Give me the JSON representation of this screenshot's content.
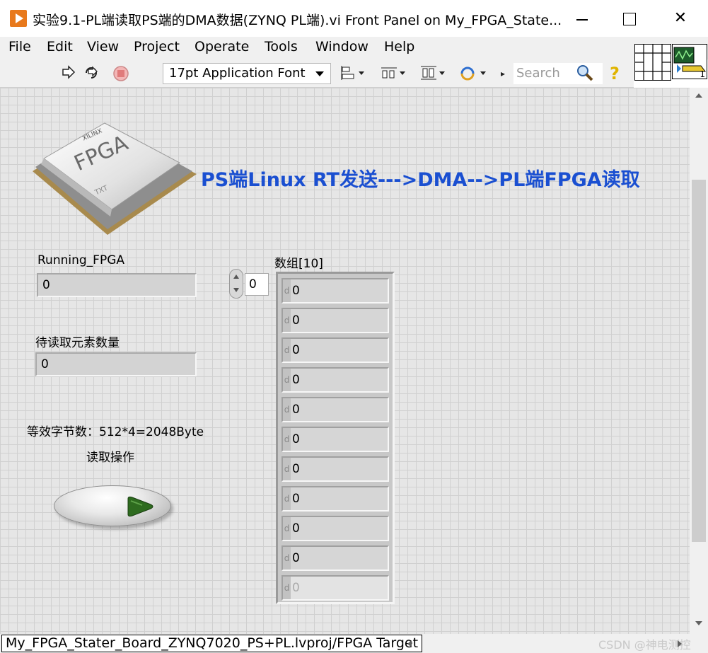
{
  "window": {
    "title": "实验9.1-PL端读取PS端的DMA数据(ZYNQ PL端).vi Front Panel on My_FPGA_State..."
  },
  "menu": {
    "items": [
      "File",
      "Edit",
      "View",
      "Project",
      "Operate",
      "Tools",
      "Window",
      "Help"
    ]
  },
  "toolbar": {
    "font_value": "17pt Application Font",
    "search_placeholder": "Search",
    "icons": [
      "run-arrow-icon",
      "run-continuously-icon",
      "abort-icon",
      "align-objects-icon",
      "distribute-objects-icon",
      "resize-objects-icon",
      "reorder-icon"
    ]
  },
  "vi_icon": {
    "badge": "1"
  },
  "panel": {
    "headline": "PS端Linux RT发送--->DMA-->PL端FPGA读取",
    "chip_label": "FPGA",
    "chip_brand": "XILINX",
    "chip_mark": "TXT",
    "running_label": "Running_FPGA",
    "running_value": "0",
    "pending_label": "待读取元素数量",
    "pending_value": "0",
    "bytes_note": "等效字节数：512*4=2048Byte",
    "read_label": "读取操作",
    "array_label": "数组[10]",
    "array_index": "0",
    "radix_glyph": "d",
    "array_values": [
      "0",
      "0",
      "0",
      "0",
      "0",
      "0",
      "0",
      "0",
      "0",
      "0",
      "0"
    ]
  },
  "status": {
    "target": "My_FPGA_Stater_Board_ZYNQ7020_PS+PL.lvproj/FPGA Target",
    "watermark": "CSDN @神电测控"
  },
  "colors": {
    "headline": "#1a4fd1",
    "app_icon": "#e8791c",
    "led_green": "#2e6b1f"
  }
}
